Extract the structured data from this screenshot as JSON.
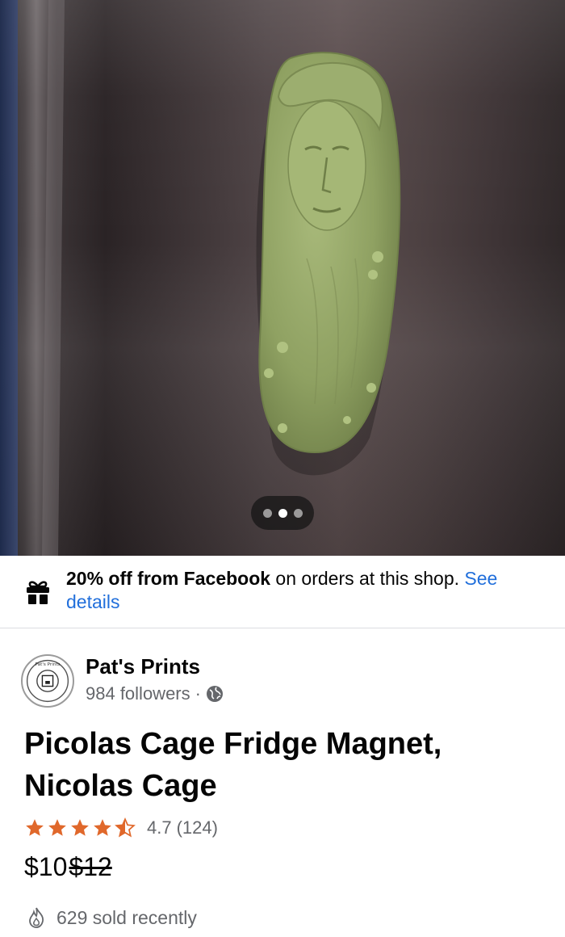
{
  "product_photo": {
    "alt": "Green 3D-printed pickle-shaped magnet with a sculpted face",
    "carousel": {
      "count": 3,
      "active_index": 1
    }
  },
  "promo": {
    "icon": "gift-icon",
    "bold_text": "20% off from Facebook",
    "text": " on orders at this shop. ",
    "link_text": "See details",
    "link_color": "#216fdb"
  },
  "seller": {
    "name": "Pat's Prints",
    "followers": "984 followers",
    "separator": " · ",
    "visibility_icon": "globe-icon",
    "logo_text": "Pat's Prints"
  },
  "listing": {
    "title": "Picolas Cage Fridge Magnet, Nicolas Cage",
    "rating": {
      "value": "4.7",
      "count": "(124)",
      "stars_full": 4,
      "stars_half": 1,
      "star_color": "#e0682b"
    },
    "price": {
      "current": "$10",
      "original": "$12"
    },
    "sold": {
      "icon": "flame-icon",
      "text": "629 sold recently"
    }
  }
}
